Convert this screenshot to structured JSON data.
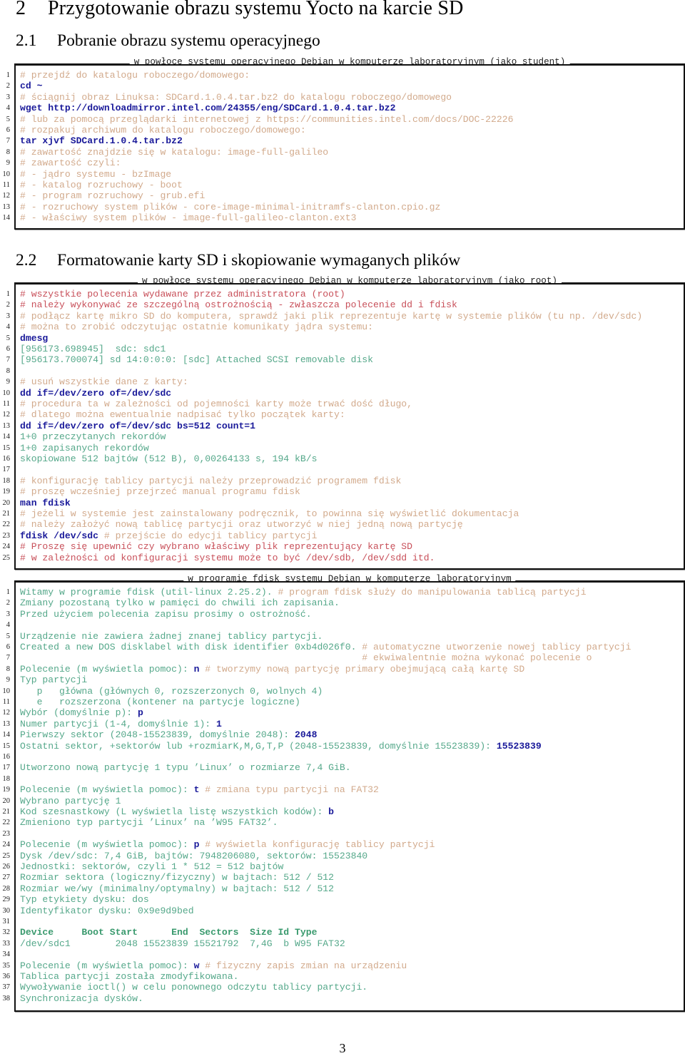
{
  "colors": {
    "comment": "#d2aa8c",
    "warning": "#c8505a",
    "command": "#1a1a9a",
    "output": "#55a88a",
    "border": "#111111"
  },
  "section": {
    "number": "2",
    "title": "Przygotowanie obrazu systemu Yocto na karcie SD"
  },
  "subsections": [
    {
      "number": "2.1",
      "title": "Pobranie obrazu systemu operacyjnego"
    },
    {
      "number": "2.2",
      "title": "Formatowanie karty SD i skopiowanie wymaganych plików"
    }
  ],
  "listings": [
    {
      "caption": "w powłoce systemu operacyjnego Debian w komputerze laboratoryjnym (jako student)",
      "lines": [
        {
          "n": "1",
          "segs": [
            {
              "t": "# przejdź do katalogu roboczego/domowego:",
              "k": "comment"
            }
          ]
        },
        {
          "n": "2",
          "segs": [
            {
              "t": "cd ~",
              "k": "cmd"
            }
          ]
        },
        {
          "n": "3",
          "segs": [
            {
              "t": "# ściągnij obraz Linuksa: SDCard.1.0.4.tar.bz2 do katalogu roboczego/domowego",
              "k": "comment"
            }
          ]
        },
        {
          "n": "4",
          "segs": [
            {
              "t": "wget http://downloadmirror.intel.com/24355/eng/SDCard.1.0.4.tar.bz2",
              "k": "cmd"
            }
          ]
        },
        {
          "n": "5",
          "segs": [
            {
              "t": "# lub za pomocą przeglądarki internetowej z https://communities.intel.com/docs/DOC-22226",
              "k": "comment"
            }
          ]
        },
        {
          "n": "6",
          "segs": [
            {
              "t": "# rozpakuj archiwum do katalogu roboczego/domowego:",
              "k": "comment"
            }
          ]
        },
        {
          "n": "7",
          "segs": [
            {
              "t": "tar xjvf SDCard.1.0.4.tar.bz2",
              "k": "cmd"
            }
          ]
        },
        {
          "n": "8",
          "segs": [
            {
              "t": "# zawartość znajdzie się w katalogu: image-full-galileo",
              "k": "comment"
            }
          ]
        },
        {
          "n": "9",
          "segs": [
            {
              "t": "# zawartość czyli:",
              "k": "comment"
            }
          ]
        },
        {
          "n": "10",
          "segs": [
            {
              "t": "# - jądro systemu - bzImage",
              "k": "comment"
            }
          ]
        },
        {
          "n": "11",
          "segs": [
            {
              "t": "# - katalog rozruchowy - boot",
              "k": "comment"
            }
          ]
        },
        {
          "n": "12",
          "segs": [
            {
              "t": "# - program rozruchowy - grub.efi",
              "k": "comment"
            }
          ]
        },
        {
          "n": "13",
          "segs": [
            {
              "t": "# - rozruchowy system plików - core-image-minimal-initramfs-clanton.cpio.gz",
              "k": "comment"
            }
          ]
        },
        {
          "n": "14",
          "segs": [
            {
              "t": "# - właściwy system plików - image-full-galileo-clanton.ext3",
              "k": "comment"
            }
          ]
        }
      ]
    },
    {
      "caption": "w powłoce systemu operacyjnego Debian w komputerze laboratoryjnym (jako root)",
      "lines": [
        {
          "n": "1",
          "segs": [
            {
              "t": "# wszystkie polecenia wydawane przez administratora (root)",
              "k": "warn"
            }
          ]
        },
        {
          "n": "2",
          "segs": [
            {
              "t": "# należy wykonywać ze szczególną ostrożnością - zwłaszcza polecenie dd i fdisk",
              "k": "warn"
            }
          ]
        },
        {
          "n": "3",
          "segs": [
            {
              "t": "# podłącz kartę mikro SD do komputera, sprawdź jaki plik reprezentuje kartę w systemie plików (tu np. /dev/sdc)",
              "k": "comment"
            }
          ]
        },
        {
          "n": "4",
          "segs": [
            {
              "t": "# można to zrobić odczytując ostatnie komunikaty jądra systemu:",
              "k": "comment"
            }
          ]
        },
        {
          "n": "5",
          "segs": [
            {
              "t": "dmesg",
              "k": "cmd"
            }
          ]
        },
        {
          "n": "6",
          "segs": [
            {
              "t": "[956173.698945]  sdc: sdc1",
              "k": "out"
            }
          ]
        },
        {
          "n": "7",
          "segs": [
            {
              "t": "[956173.700074] sd 14:0:0:0: [sdc] Attached SCSI removable disk",
              "k": "out"
            }
          ]
        },
        {
          "n": "8",
          "segs": []
        },
        {
          "n": "9",
          "segs": [
            {
              "t": "# usuń wszystkie dane z karty:",
              "k": "comment"
            }
          ]
        },
        {
          "n": "10",
          "segs": [
            {
              "t": "dd if=/dev/zero of=/dev/sdc",
              "k": "cmd"
            }
          ]
        },
        {
          "n": "11",
          "segs": [
            {
              "t": "# procedura ta w zależności od pojemności karty może trwać dość długo,",
              "k": "comment"
            }
          ]
        },
        {
          "n": "12",
          "segs": [
            {
              "t": "# dlatego można ewentualnie nadpisać tylko początek karty:",
              "k": "comment"
            }
          ]
        },
        {
          "n": "13",
          "segs": [
            {
              "t": "dd if=/dev/zero of=/dev/sdc bs=512 count=1",
              "k": "cmd"
            }
          ]
        },
        {
          "n": "14",
          "segs": [
            {
              "t": "1+0 przeczytanych rekordów",
              "k": "out"
            }
          ]
        },
        {
          "n": "15",
          "segs": [
            {
              "t": "1+0 zapisanych rekordów",
              "k": "out"
            }
          ]
        },
        {
          "n": "16",
          "segs": [
            {
              "t": "skopiowane 512 bajtów (512 B), 0,00264133 s, 194 kB/s",
              "k": "out"
            }
          ]
        },
        {
          "n": "17",
          "segs": []
        },
        {
          "n": "18",
          "segs": [
            {
              "t": "# konfigurację tablicy partycji należy przeprowadzić programem fdisk",
              "k": "comment"
            }
          ]
        },
        {
          "n": "19",
          "segs": [
            {
              "t": "# proszę wcześniej przejrzeć manual programu fdisk",
              "k": "comment"
            }
          ]
        },
        {
          "n": "20",
          "segs": [
            {
              "t": "man fdisk",
              "k": "cmd"
            }
          ]
        },
        {
          "n": "21",
          "segs": [
            {
              "t": "# jeżeli w systemie jest zainstalowany podręcznik, to powinna się wyświetlić dokumentacja",
              "k": "comment"
            }
          ]
        },
        {
          "n": "22",
          "segs": [
            {
              "t": "# należy założyć nową tablicę partycji oraz utworzyć w niej jedną nową partycję",
              "k": "comment"
            }
          ]
        },
        {
          "n": "23",
          "segs": [
            {
              "t": "fdisk /dev/sdc",
              "k": "cmd"
            },
            {
              "t": " # przejście do edycji tablicy partycji",
              "k": "comment"
            }
          ]
        },
        {
          "n": "24",
          "segs": [
            {
              "t": "# Proszę się upewnić czy wybrano właściwy plik reprezentujący kartę SD",
              "k": "warn"
            }
          ]
        },
        {
          "n": "25",
          "segs": [
            {
              "t": "# w zależności od konfiguracji systemu może to być /dev/sdb, /dev/sdd itd.",
              "k": "warn"
            }
          ]
        }
      ]
    },
    {
      "caption": "w programie fdisk systemu Debian w komputerze laboratoryjnym",
      "lines": [
        {
          "n": "1",
          "segs": [
            {
              "t": "Witamy w programie fdisk (util-linux 2.25.2).",
              "k": "out"
            },
            {
              "t": " # program fdisk służy do manipulowania tablicą partycji",
              "k": "comment"
            }
          ]
        },
        {
          "n": "2",
          "segs": [
            {
              "t": "Zmiany pozostaną tylko w pamięci do chwili ich zapisania.",
              "k": "out"
            }
          ]
        },
        {
          "n": "3",
          "segs": [
            {
              "t": "Przed użyciem polecenia zapisu prosimy o ostrożność.",
              "k": "out"
            }
          ]
        },
        {
          "n": "4",
          "segs": []
        },
        {
          "n": "5",
          "segs": [
            {
              "t": "Urządzenie nie zawiera żadnej znanej tablicy partycji.",
              "k": "out"
            }
          ]
        },
        {
          "n": "6",
          "segs": [
            {
              "t": "Created a new DOS disklabel with disk identifier 0xb4d026f0.",
              "k": "out"
            },
            {
              "t": " # automatyczne utworzenie nowej tablicy partycji",
              "k": "comment"
            }
          ]
        },
        {
          "n": "7",
          "segs": [
            {
              "t": "                                                             # ekwiwalentnie można wykonać polecenie o",
              "k": "comment"
            }
          ]
        },
        {
          "n": "8",
          "segs": [
            {
              "t": "Polecenie (m wyświetla pomoc): ",
              "k": "out"
            },
            {
              "t": "n",
              "k": "in"
            },
            {
              "t": " # tworzymy nową partycję primary obejmującą całą kartę SD",
              "k": "comment"
            }
          ]
        },
        {
          "n": "9",
          "segs": [
            {
              "t": "Typ partycji",
              "k": "out"
            }
          ]
        },
        {
          "n": "10",
          "segs": [
            {
              "t": "   p   główna (głównych 0, rozszerzonych 0, wolnych 4)",
              "k": "out"
            }
          ]
        },
        {
          "n": "11",
          "segs": [
            {
              "t": "   e   rozszerzona (kontener na partycje logiczne)",
              "k": "out"
            }
          ]
        },
        {
          "n": "12",
          "segs": [
            {
              "t": "Wybór (domyślnie p): ",
              "k": "out"
            },
            {
              "t": "p",
              "k": "in"
            }
          ]
        },
        {
          "n": "13",
          "segs": [
            {
              "t": "Numer partycji (1-4, domyślnie 1): ",
              "k": "out"
            },
            {
              "t": "1",
              "k": "in"
            }
          ]
        },
        {
          "n": "14",
          "segs": [
            {
              "t": "Pierwszy sektor (2048-15523839, domyślnie 2048): ",
              "k": "out"
            },
            {
              "t": "2048",
              "k": "in"
            }
          ]
        },
        {
          "n": "15",
          "segs": [
            {
              "t": "Ostatni sektor, +sektorów lub +rozmiarK,M,G,T,P (2048-15523839, domyślnie 15523839): ",
              "k": "out"
            },
            {
              "t": "15523839",
              "k": "in"
            }
          ]
        },
        {
          "n": "16",
          "segs": []
        },
        {
          "n": "17",
          "segs": [
            {
              "t": "Utworzono nową partycję 1 typu ’Linux’ o rozmiarze 7,4 GiB.",
              "k": "out"
            }
          ]
        },
        {
          "n": "18",
          "segs": []
        },
        {
          "n": "19",
          "segs": [
            {
              "t": "Polecenie (m wyświetla pomoc): ",
              "k": "out"
            },
            {
              "t": "t",
              "k": "in"
            },
            {
              "t": " # zmiana typu partycji na FAT32",
              "k": "comment"
            }
          ]
        },
        {
          "n": "20",
          "segs": [
            {
              "t": "Wybrano partycję 1",
              "k": "out"
            }
          ]
        },
        {
          "n": "21",
          "segs": [
            {
              "t": "Kod szesnastkowy (L wyświetla listę wszystkich kodów): ",
              "k": "out"
            },
            {
              "t": "b",
              "k": "in"
            }
          ]
        },
        {
          "n": "22",
          "segs": [
            {
              "t": "Zmieniono typ partycji ’Linux’ na ’W95 FAT32’.",
              "k": "out"
            }
          ]
        },
        {
          "n": "23",
          "segs": []
        },
        {
          "n": "24",
          "segs": [
            {
              "t": "Polecenie (m wyświetla pomoc): ",
              "k": "out"
            },
            {
              "t": "p",
              "k": "in"
            },
            {
              "t": " # wyświetla konfigurację tablicy partycji",
              "k": "comment"
            }
          ]
        },
        {
          "n": "25",
          "segs": [
            {
              "t": "Dysk /dev/sdc: 7,4 GiB, bajtów: 7948206080, sektorów: 15523840",
              "k": "out"
            }
          ]
        },
        {
          "n": "26",
          "segs": [
            {
              "t": "Jednostki: sektorów, czyli 1 * 512 = 512 bajtów",
              "k": "out"
            }
          ]
        },
        {
          "n": "27",
          "segs": [
            {
              "t": "Rozmiar sektora (logiczny/fizyczny) w bajtach: 512 / 512",
              "k": "out"
            }
          ]
        },
        {
          "n": "28",
          "segs": [
            {
              "t": "Rozmiar we/wy (minimalny/optymalny) w bajtach: 512 / 512",
              "k": "out"
            }
          ]
        },
        {
          "n": "29",
          "segs": [
            {
              "t": "Typ etykiety dysku: dos",
              "k": "out"
            }
          ]
        },
        {
          "n": "30",
          "segs": [
            {
              "t": "Identyfikator dysku: 0x9e9d9bed",
              "k": "out"
            }
          ]
        },
        {
          "n": "31",
          "segs": []
        },
        {
          "n": "32",
          "segs": [
            {
              "t": "Device     Boot Start      End  Sectors  Size Id Type",
              "k": "outbold"
            }
          ]
        },
        {
          "n": "33",
          "segs": [
            {
              "t": "/dev/sdc1        2048 15523839 15521792  7,4G  b W95 FAT32",
              "k": "out"
            }
          ]
        },
        {
          "n": "34",
          "segs": []
        },
        {
          "n": "35",
          "segs": [
            {
              "t": "Polecenie (m wyświetla pomoc): ",
              "k": "out"
            },
            {
              "t": "w",
              "k": "in"
            },
            {
              "t": " # fizyczny zapis zmian na urządzeniu",
              "k": "comment"
            }
          ]
        },
        {
          "n": "36",
          "segs": [
            {
              "t": "Tablica partycji została zmodyfikowana.",
              "k": "out"
            }
          ]
        },
        {
          "n": "37",
          "segs": [
            {
              "t": "Wywoływanie ioctl() w celu ponownego odczytu tablicy partycji.",
              "k": "out"
            }
          ]
        },
        {
          "n": "38",
          "segs": [
            {
              "t": "Synchronizacja dysków.",
              "k": "out"
            }
          ]
        }
      ]
    }
  ],
  "page_number": "3"
}
